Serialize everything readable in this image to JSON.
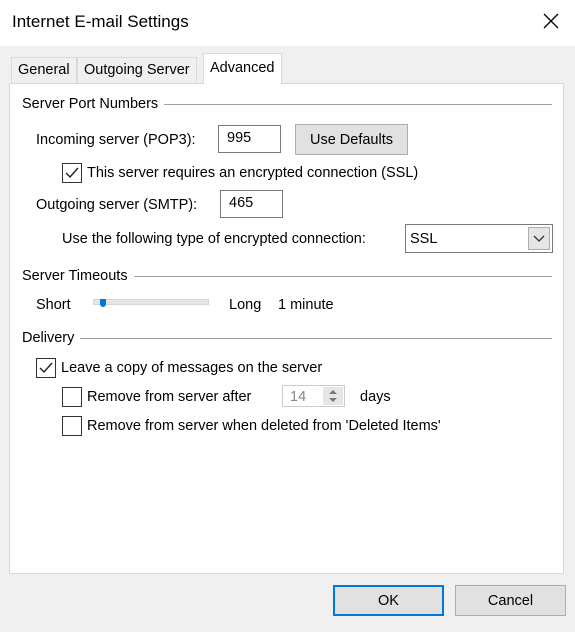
{
  "window": {
    "title": "Internet E-mail Settings",
    "close_icon": "close-icon"
  },
  "tabs": [
    {
      "label": "General"
    },
    {
      "label": "Outgoing Server"
    },
    {
      "label": "Advanced",
      "active": true
    }
  ],
  "ports": {
    "group_label": "Server Port Numbers",
    "incoming_label": "Incoming server (POP3):",
    "incoming_value": "995",
    "use_defaults": "Use Defaults",
    "ssl_checkbox_label": "This server requires an encrypted connection (SSL)",
    "ssl_checked": true,
    "outgoing_label": "Outgoing server (SMTP):",
    "outgoing_value": "465",
    "encryption_label": "Use the following type of encrypted connection:",
    "encryption_value": "SSL"
  },
  "timeouts": {
    "group_label": "Server Timeouts",
    "short_label": "Short",
    "long_label": "Long",
    "value_label": "1 minute",
    "slider_level": 0.05
  },
  "delivery": {
    "group_label": "Delivery",
    "leave_copy_label": "Leave a copy of messages on the server",
    "leave_copy_checked": true,
    "remove_after_label": "Remove from server after",
    "remove_after_checked": false,
    "remove_after_days": "14",
    "days_label": "days",
    "remove_deleted_label": "Remove from server when deleted from 'Deleted Items'",
    "remove_deleted_checked": false
  },
  "buttons": {
    "ok": "OK",
    "cancel": "Cancel"
  },
  "colors": {
    "accent": "#0078d7"
  }
}
